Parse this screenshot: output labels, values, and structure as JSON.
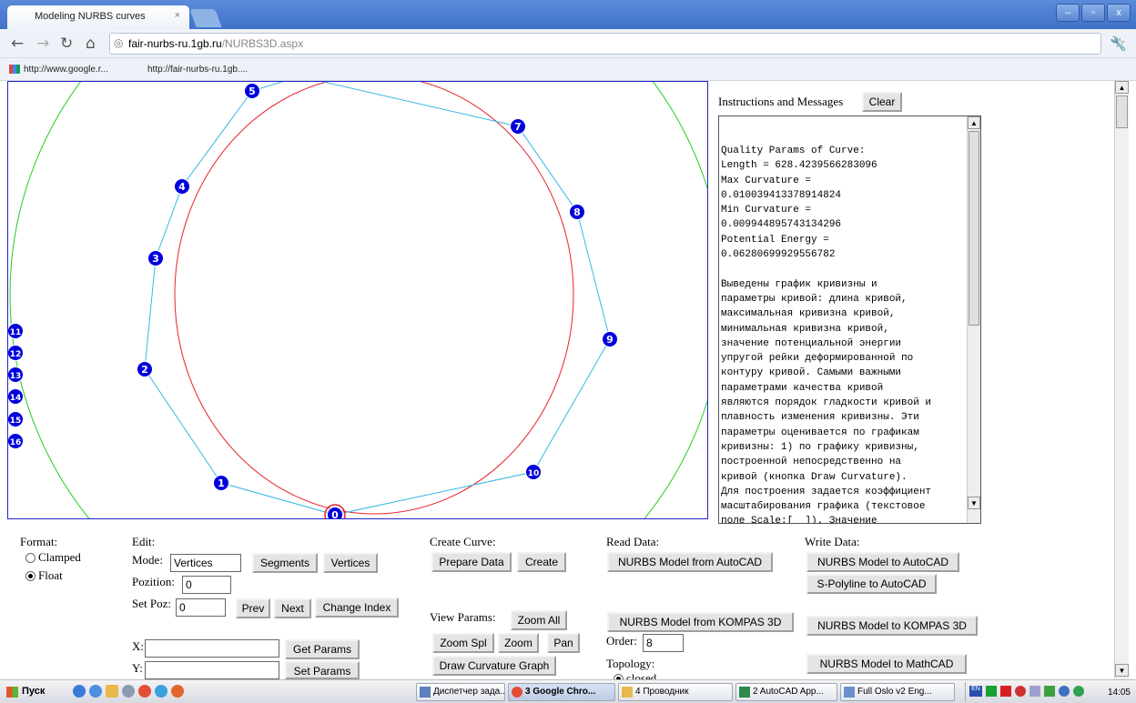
{
  "browser": {
    "tab_title": "Modeling NURBS curves",
    "tab_close": "×",
    "window_buttons": [
      "–",
      "▫",
      "x"
    ],
    "url_host": "fair-nurbs-ru.1gb.ru",
    "url_path": "/NURBS3D.aspx",
    "bookmarks": [
      "http://www.google.r...",
      "http://fair-nurbs-ru.1gb...."
    ]
  },
  "canvas": {
    "ctrl_points": [
      {
        "label": "0"
      },
      {
        "label": "1"
      },
      {
        "label": "2"
      },
      {
        "label": "3"
      },
      {
        "label": "4"
      },
      {
        "label": "5"
      },
      {
        "label": "7"
      },
      {
        "label": "8"
      },
      {
        "label": "9"
      },
      {
        "label": "10"
      },
      {
        "label": "11"
      },
      {
        "label": "12"
      },
      {
        "label": "13"
      },
      {
        "label": "14"
      },
      {
        "label": "15"
      },
      {
        "label": "16"
      }
    ],
    "colors": {
      "curve": "#e8202a",
      "polygon": "#35b7e6",
      "outer_circle": "#22cc22",
      "point_fill": "#0000dd"
    }
  },
  "messages": {
    "header": "Instructions and Messages",
    "clear_label": "Clear",
    "text": "Quality Params of Curve:\nLength = 628.4239566283096\nMax Curvature =\n0.010039413378914824\nMin Curvature =\n0.009944895743134296\nPotential Energy =\n0.06280699929556782\n\nВыведены график кривизны и\nпараметры кривой: длина кривой,\nмаксимальная кривизна кривой,\nминимальная кривизна кривой,\nзначение потенциальной энергии\nупругой рейки деформированной по\nконтуру кривой. Самыми важными\nпараметрами качества кривой\nявляются порядок гладкости кривой и\nплавность изменения кривизны. Эти\nпараметры оценивается по графикам\nкривизны: 1) по графику кривизны,\nпостроенной непосредственно на\nкривой (кнопка Draw Curvature).\nДля построения задается коэффициент\nмасштабирования графика (текстовое\nполе Scale:[  ]). Значение\nкоэффициента задает отношение"
  },
  "controls": {
    "format_label": "Format:",
    "format_options": [
      "Clamped",
      "Float"
    ],
    "edit_label": "Edit:",
    "mode_label": "Mode:",
    "mode_value": "Vertices",
    "segments_btn": "Segments",
    "vertices_btn": "Vertices",
    "pozition_label": "Pozition:",
    "pozition_value": "0",
    "setpoz_label": "Set Poz:",
    "setpoz_value": "0",
    "prev_btn": "Prev",
    "next_btn": "Next",
    "change_index_btn": "Change Index",
    "x_label": "X:",
    "y_label": "Y:",
    "get_params_btn": "Get Params",
    "set_params_btn": "Set Params",
    "create_curve_label": "Create Curve:",
    "prepare_data_btn": "Prepare Data",
    "create_btn": "Create",
    "view_params_label": "View Params:",
    "zoom_all_btn": "Zoom All",
    "zoom_spl_btn": "Zoom Spl",
    "zoom_btn": "Zoom",
    "pan_btn": "Pan",
    "draw_curvature_btn": "Draw Curvature Graph",
    "read_data_label": "Read Data:",
    "read_autocad_btn": "NURBS Model from AutoCAD",
    "read_kompas_btn": "NURBS Model from KOMPAS 3D",
    "order_label": "Order:",
    "order_value": "8",
    "topology_label": "Topology:",
    "topology_option": "closed",
    "write_data_label": "Write Data:",
    "write_autocad_btn": "NURBS Model to AutoCAD",
    "spolyline_btn": "S-Polyline to AutoCAD",
    "write_kompas_btn": "NURBS Model to KOMPAS 3D",
    "write_mathcad_btn": "NURBS Model to MathCAD"
  },
  "taskbar": {
    "start_label": "Пуск",
    "tasks": [
      "Диспетчер зада...",
      "3 Google Chro...",
      "4 Проводник",
      "2 AutoCAD App...",
      "Full Oslo v2 Eng..."
    ],
    "lang": "EN",
    "clock": "14:05"
  }
}
